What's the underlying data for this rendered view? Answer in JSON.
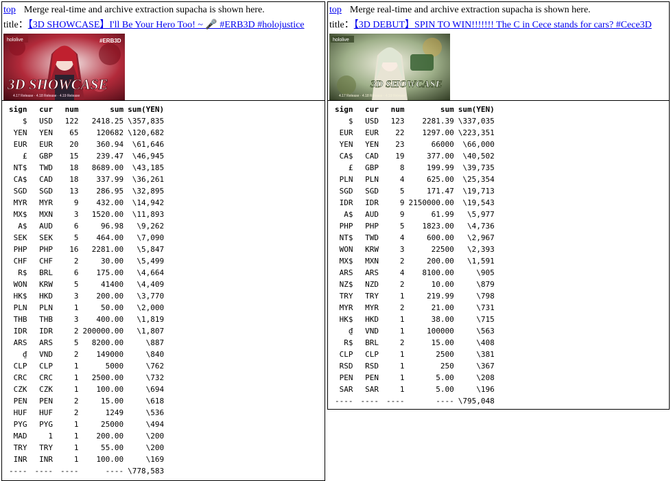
{
  "colors": {
    "link": "#0000ee",
    "border": "#000000",
    "background": "#ffffff"
  },
  "columns": [
    "sign",
    "cur",
    "num",
    "sum",
    "sum(YEN)"
  ],
  "left": {
    "top_link": "top",
    "description": "Merge real-time and archive extraction supacha is shown here.",
    "title_label": "title：",
    "title_link": "【3D SHOWCASE】I'll Be Your Hero Too! ~ 🎤 #ERB3D #holojustice",
    "thumbnail": {
      "badge_left": "hololive",
      "badge_right": "#ERB3D",
      "caption": "3D SHOWCASE",
      "subcaption": "4.17 Release · 4.18 Release · 4.19 Release"
    },
    "rows": [
      [
        "$",
        "USD",
        "122",
        "2418.25",
        "\\357,835"
      ],
      [
        "YEN",
        "YEN",
        "65",
        "120682",
        "\\120,682"
      ],
      [
        "EUR",
        "EUR",
        "20",
        "360.94",
        "\\61,646"
      ],
      [
        "£",
        "GBP",
        "15",
        "239.47",
        "\\46,945"
      ],
      [
        "NT$",
        "TWD",
        "18",
        "8689.00",
        "\\43,185"
      ],
      [
        "CA$",
        "CAD",
        "18",
        "337.99",
        "\\36,261"
      ],
      [
        "SGD",
        "SGD",
        "13",
        "286.95",
        "\\32,895"
      ],
      [
        "MYR",
        "MYR",
        "9",
        "432.00",
        "\\14,942"
      ],
      [
        "MX$",
        "MXN",
        "3",
        "1520.00",
        "\\11,893"
      ],
      [
        "A$",
        "AUD",
        "6",
        "96.98",
        "\\9,262"
      ],
      [
        "SEK",
        "SEK",
        "5",
        "464.00",
        "\\7,090"
      ],
      [
        "PHP",
        "PHP",
        "16",
        "2281.00",
        "\\5,847"
      ],
      [
        "CHF",
        "CHF",
        "2",
        "30.00",
        "\\5,499"
      ],
      [
        "R$",
        "BRL",
        "6",
        "175.00",
        "\\4,664"
      ],
      [
        "WON",
        "KRW",
        "5",
        "41400",
        "\\4,409"
      ],
      [
        "HK$",
        "HKD",
        "3",
        "200.00",
        "\\3,770"
      ],
      [
        "PLN",
        "PLN",
        "1",
        "50.00",
        "\\2,000"
      ],
      [
        "THB",
        "THB",
        "3",
        "400.00",
        "\\1,819"
      ],
      [
        "IDR",
        "IDR",
        "2",
        "200000.00",
        "\\1,807"
      ],
      [
        "ARS",
        "ARS",
        "5",
        "8200.00",
        "\\887"
      ],
      [
        "₫",
        "VND",
        "2",
        "149000",
        "\\840"
      ],
      [
        "CLP",
        "CLP",
        "1",
        "5000",
        "\\762"
      ],
      [
        "CRC",
        "CRC",
        "1",
        "2500.00",
        "\\732"
      ],
      [
        "CZK",
        "CZK",
        "1",
        "100.00",
        "\\694"
      ],
      [
        "PEN",
        "PEN",
        "2",
        "15.00",
        "\\618"
      ],
      [
        "HUF",
        "HUF",
        "2",
        "1249",
        "\\536"
      ],
      [
        "PYG",
        "PYG",
        "1",
        "25000",
        "\\494"
      ],
      [
        "MAD",
        "1",
        "1",
        "200.00",
        "\\200"
      ],
      [
        "TRY",
        "TRY",
        "1",
        "55.00",
        "\\200"
      ],
      [
        "INR",
        "INR",
        "1",
        "100.00",
        "\\169"
      ]
    ],
    "total_row": [
      "----",
      "----",
      "----",
      "----",
      "\\778,583"
    ]
  },
  "right": {
    "top_link": "top",
    "description": "Merge real-time and archive extraction supacha is shown here.",
    "title_label": "title：",
    "title_link": "【3D DEBUT】SPIN TO WIN!!!!!!! The C in Cece stands for cars? #Cece3D",
    "thumbnail": {
      "badge_left": "hololive",
      "caption": "3D SHOWCASE",
      "subcaption": "4.17 Release · 4.18 Release · 4.19 Release"
    },
    "rows": [
      [
        "$",
        "USD",
        "123",
        "2281.39",
        "\\337,035"
      ],
      [
        "EUR",
        "EUR",
        "22",
        "1297.00",
        "\\223,351"
      ],
      [
        "YEN",
        "YEN",
        "23",
        "66000",
        "\\66,000"
      ],
      [
        "CA$",
        "CAD",
        "19",
        "377.00",
        "\\40,502"
      ],
      [
        "£",
        "GBP",
        "8",
        "199.99",
        "\\39,735"
      ],
      [
        "PLN",
        "PLN",
        "4",
        "625.00",
        "\\25,354"
      ],
      [
        "SGD",
        "SGD",
        "5",
        "171.47",
        "\\19,713"
      ],
      [
        "IDR",
        "IDR",
        "9",
        "2150000.00",
        "\\19,543"
      ],
      [
        "A$",
        "AUD",
        "9",
        "61.99",
        "\\5,977"
      ],
      [
        "PHP",
        "PHP",
        "5",
        "1823.00",
        "\\4,736"
      ],
      [
        "NT$",
        "TWD",
        "4",
        "600.00",
        "\\2,967"
      ],
      [
        "WON",
        "KRW",
        "3",
        "22500",
        "\\2,393"
      ],
      [
        "MX$",
        "MXN",
        "2",
        "200.00",
        "\\1,591"
      ],
      [
        "ARS",
        "ARS",
        "4",
        "8100.00",
        "\\905"
      ],
      [
        "NZ$",
        "NZD",
        "2",
        "10.00",
        "\\879"
      ],
      [
        "TRY",
        "TRY",
        "1",
        "219.99",
        "\\798"
      ],
      [
        "MYR",
        "MYR",
        "2",
        "21.00",
        "\\731"
      ],
      [
        "HK$",
        "HKD",
        "1",
        "38.00",
        "\\715"
      ],
      [
        "₫",
        "VND",
        "1",
        "100000",
        "\\563"
      ],
      [
        "R$",
        "BRL",
        "2",
        "15.00",
        "\\408"
      ],
      [
        "CLP",
        "CLP",
        "1",
        "2500",
        "\\381"
      ],
      [
        "RSD",
        "RSD",
        "1",
        "250",
        "\\367"
      ],
      [
        "PEN",
        "PEN",
        "1",
        "5.00",
        "\\208"
      ],
      [
        "SAR",
        "SAR",
        "1",
        "5.00",
        "\\196"
      ]
    ],
    "total_row": [
      "----",
      "----",
      "----",
      "----",
      "\\795,048"
    ]
  }
}
